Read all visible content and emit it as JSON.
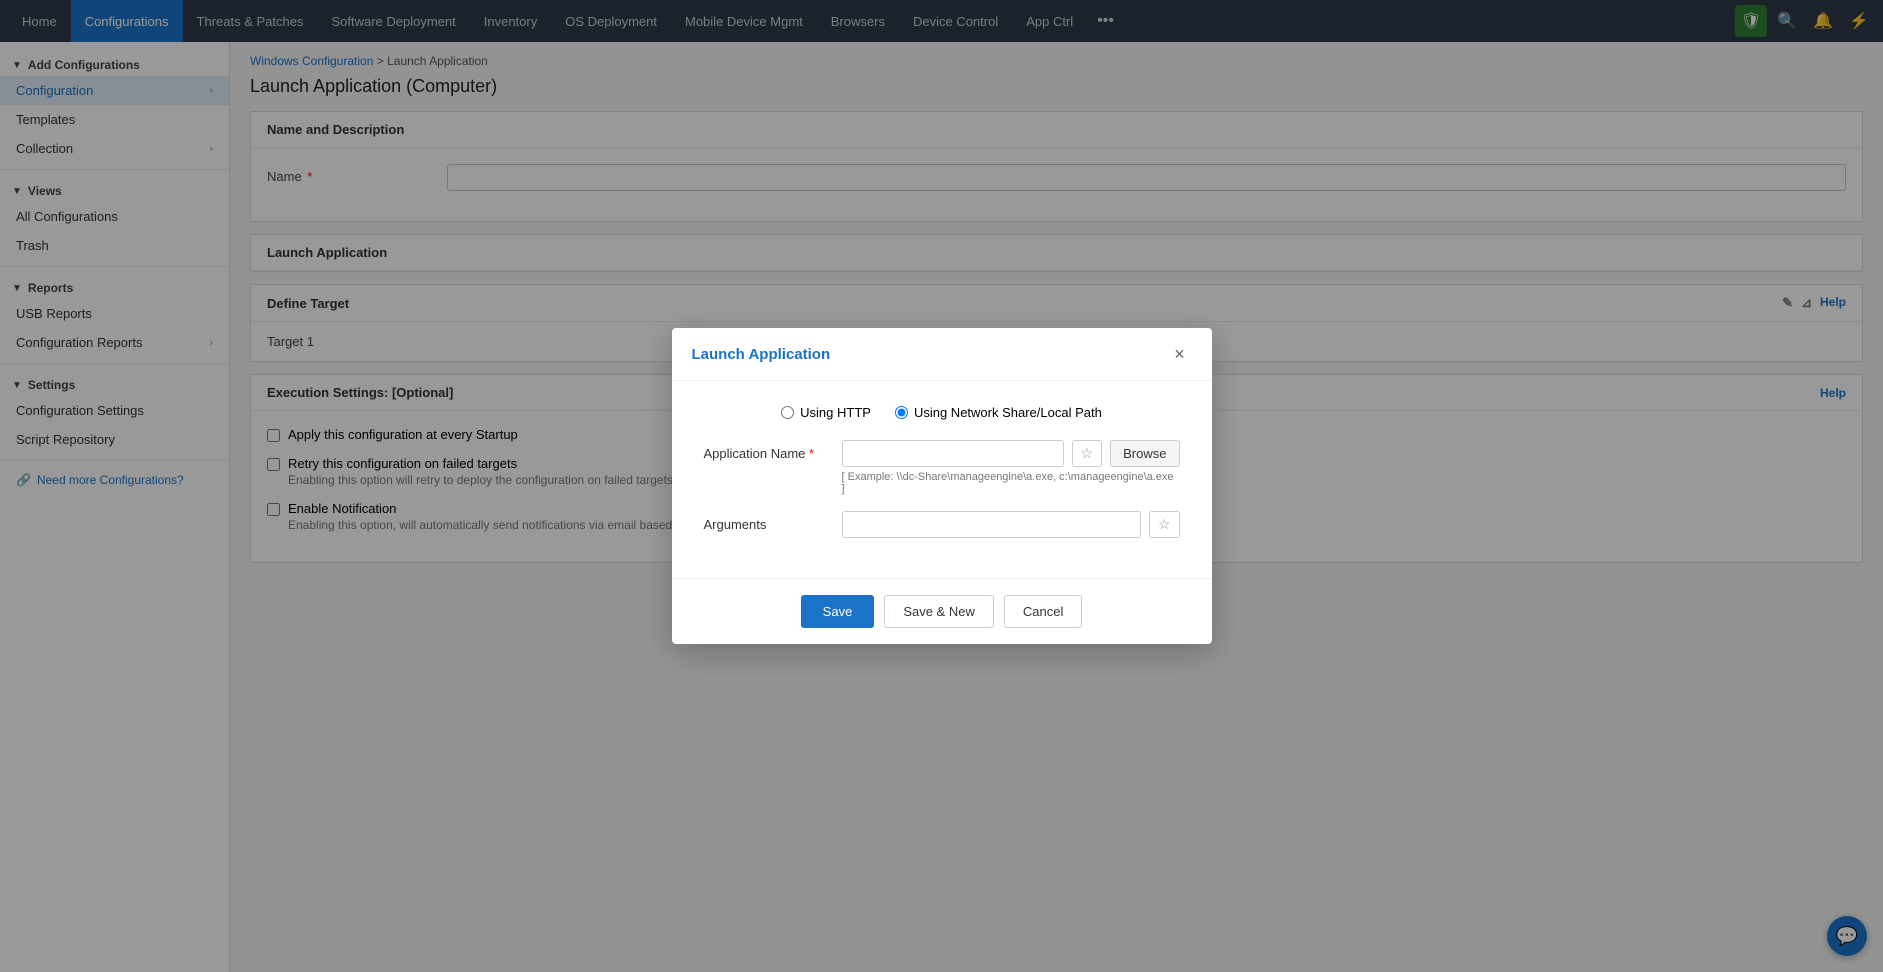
{
  "nav": {
    "items": [
      {
        "label": "Home",
        "active": false
      },
      {
        "label": "Configurations",
        "active": true
      },
      {
        "label": "Threats & Patches",
        "active": false
      },
      {
        "label": "Software Deployment",
        "active": false
      },
      {
        "label": "Inventory",
        "active": false
      },
      {
        "label": "OS Deployment",
        "active": false
      },
      {
        "label": "Mobile Device Mgmt",
        "active": false
      },
      {
        "label": "Browsers",
        "active": false
      },
      {
        "label": "Device Control",
        "active": false
      },
      {
        "label": "App Ctrl",
        "active": false
      }
    ],
    "more_label": "•••"
  },
  "sidebar": {
    "add_configurations_label": "Add Configurations",
    "configuration_label": "Configuration",
    "templates_label": "Templates",
    "collection_label": "Collection",
    "views_label": "Views",
    "all_configurations_label": "All Configurations",
    "trash_label": "Trash",
    "reports_label": "Reports",
    "usb_reports_label": "USB Reports",
    "configuration_reports_label": "Configuration Reports",
    "settings_label": "Settings",
    "configuration_settings_label": "Configuration Settings",
    "script_repository_label": "Script Repository",
    "need_more_link": "Need more Configurations?"
  },
  "breadcrumb": {
    "part1": "Windows Configuration",
    "separator": " > ",
    "part2": "Launch Application"
  },
  "page_title": "Launch Application (Computer)",
  "name_section": {
    "header": "Name and Description",
    "name_label": "Name",
    "required": "*"
  },
  "launch_application_section": {
    "label": "Launch Application"
  },
  "define_target_section": {
    "header": "Define Target",
    "target1_label": "Target 1",
    "help_label": "Help"
  },
  "execution_section": {
    "header": "Execution Settings: [Optional]",
    "help_label": "Help",
    "checkbox1_label": "Apply this configuration at every Startup",
    "checkbox2_label": "Retry this configuration on failed targets",
    "checkbox2_desc": "Enabling this option will retry to deploy the configuration on failed targets.",
    "checkbox3_label": "Enable Notification",
    "checkbox3_desc": "Enabling this option, will automatically send notifications via email based on the specified frequency"
  },
  "modal": {
    "title": "Launch Application",
    "close_label": "×",
    "radio_http_label": "Using HTTP",
    "radio_network_label": "Using Network Share/Local Path",
    "app_name_label": "Application Name",
    "app_name_required": "*",
    "app_name_placeholder": "",
    "app_name_hint": "[ Example: \\\\dc-Share\\manageengine\\a.exe, c:\\manageengine\\a.exe ]",
    "browse_label": "Browse",
    "arguments_label": "Arguments",
    "save_label": "Save",
    "save_new_label": "Save & New",
    "cancel_label": "Cancel"
  }
}
